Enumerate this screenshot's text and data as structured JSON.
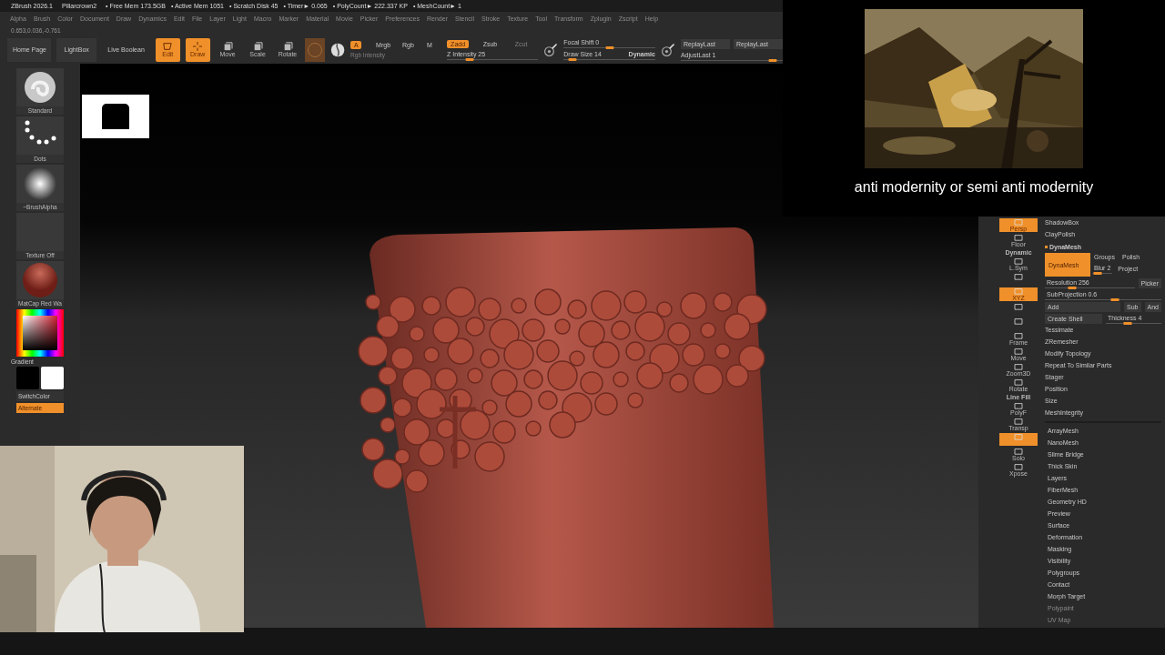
{
  "title_bar": {
    "app": "ZBrush 2026.1",
    "file": "Pillarcrown2",
    "stats": [
      "• Free Mem 173.5GB",
      "• Active Mem 1051",
      "• Scratch Disk 45",
      "• Timer► 0.065",
      "• PolyCount► 222.337 KP",
      "• MeshCount► 1"
    ]
  },
  "menus": [
    "Alpha",
    "Brush",
    "Color",
    "Document",
    "Draw",
    "Dynamics",
    "Edit",
    "File",
    "Layer",
    "Light",
    "Macro",
    "Marker",
    "Material",
    "Movie",
    "Picker",
    "Preferences",
    "Render",
    "Stencil",
    "Stroke",
    "Texture",
    "Tool",
    "Transform",
    "Zplugin",
    "Zscript",
    "Help"
  ],
  "coordinates": "0.653,0.036,-0.761",
  "nav_buttons": [
    "Home Page",
    "LightBox",
    "Live Boolean"
  ],
  "tools": [
    {
      "kind": "edit",
      "label": "Edit",
      "selected": true
    },
    {
      "kind": "draw",
      "label": "Draw",
      "selected": true
    },
    {
      "kind": "move",
      "label": "Move",
      "selected": false
    },
    {
      "kind": "scale",
      "label": "Scale",
      "selected": false
    },
    {
      "kind": "rotate",
      "label": "Rotate",
      "selected": false
    }
  ],
  "color_modes": [
    {
      "label": "A",
      "selected": true
    },
    {
      "label": "Mrgb",
      "selected": false
    },
    {
      "label": "Rgb",
      "selected": false
    },
    {
      "label": "M",
      "selected": false
    }
  ],
  "rgb_intensity": {
    "label": "Rgb Intensity",
    "disabled": true
  },
  "depth_modes": [
    {
      "label": "Zadd",
      "selected": true,
      "disabled": false
    },
    {
      "label": "Zsub",
      "selected": false,
      "disabled": false
    },
    {
      "label": "Zcut",
      "selected": false,
      "disabled": true
    }
  ],
  "z_intensity": {
    "label": "Z Intensity 25",
    "level": 0.25
  },
  "focal_shift": {
    "label": "Focal Shift 0",
    "level": 0.5
  },
  "draw_size": {
    "label": "Draw Size 14",
    "level": 0.1,
    "mode": "Dynamic"
  },
  "replay_buttons": [
    "ReplayLast",
    "ReplayLast"
  ],
  "adjust_last": {
    "label": "AdjustLast 1",
    "level": 0.9
  },
  "brush_tiles": [
    {
      "kind": "brush",
      "label": "Standard"
    },
    {
      "kind": "dots",
      "label": "Dots"
    },
    {
      "kind": "alpha",
      "label": "~BrushAlpha"
    },
    {
      "kind": "texture",
      "label": "Texture Off"
    },
    {
      "kind": "material",
      "label": "MatCap Red Wa"
    }
  ],
  "gradient_label": "Gradient",
  "switch_color": "SwitchColor",
  "alternate": {
    "label": "Alternate",
    "on": true
  },
  "view_tools": [
    {
      "kind": "button",
      "label": "Persp",
      "selected": true
    },
    {
      "kind": "button",
      "label": "Floor",
      "selected": false
    },
    {
      "kind": "caption",
      "label": "Dynamic"
    },
    {
      "kind": "button",
      "label": "L.Sym",
      "selected": false
    },
    {
      "kind": "button",
      "selected": false
    },
    {
      "kind": "button",
      "label": "XYZ",
      "selected": true
    },
    {
      "kind": "button",
      "selected": false
    },
    {
      "kind": "button",
      "selected": false
    },
    {
      "kind": "button",
      "label": "Frame",
      "selected": false
    },
    {
      "kind": "button",
      "label": "Move",
      "selected": false
    },
    {
      "kind": "button",
      "label": "Zoom3D",
      "selected": false
    },
    {
      "kind": "button",
      "label": "Rotate",
      "selected": false
    },
    {
      "kind": "caption",
      "label": "Line Fill"
    },
    {
      "kind": "button",
      "label": "PolyF",
      "selected": false
    },
    {
      "kind": "button",
      "label": "Transp",
      "selected": false
    },
    {
      "kind": "button",
      "selected": true
    },
    {
      "kind": "button",
      "label": "Solo",
      "selected": false
    },
    {
      "kind": "button",
      "label": "Xpose",
      "selected": false
    }
  ],
  "subpalette_items": [
    "ShadowBox",
    "ClayPolish"
  ],
  "dynamesh": {
    "title": "DynaMesh",
    "expanded": true,
    "button": {
      "label": "DynaMesh",
      "on": true
    },
    "groups": "Groups",
    "polish": "Polish",
    "blur": {
      "label": "Blur 2",
      "level": 0.25
    },
    "project": "Project",
    "resolution": {
      "label": "Resolution 256",
      "level": 0.3
    },
    "picker": "Picker",
    "subprojection": {
      "label": "SubProjection 0.6",
      "level": 0.6
    },
    "add": "Add",
    "sub": "Sub",
    "and": "And",
    "create_shell": "Create Shell",
    "thickness": {
      "label": "Thickness 4",
      "level": 0.4
    }
  },
  "geometry_items": [
    "Tessimate",
    "ZRemesher",
    "Modify Topology",
    "Repeat To Similar Parts",
    "Stager",
    "Position",
    "Size",
    "MeshIntegrity"
  ],
  "tool_items": [
    {
      "label": "ArrayMesh",
      "disabled": false
    },
    {
      "label": "NanoMesh",
      "disabled": false
    },
    {
      "label": "Slime Bridge",
      "disabled": false
    },
    {
      "label": "Thick Skin",
      "disabled": false
    },
    {
      "label": "Layers",
      "disabled": false
    },
    {
      "label": "FiberMesh",
      "disabled": false
    },
    {
      "label": "Geometry HD",
      "disabled": false
    },
    {
      "label": "Preview",
      "disabled": false
    },
    {
      "label": "Surface",
      "disabled": false
    },
    {
      "label": "Deformation",
      "disabled": false
    },
    {
      "label": "Masking",
      "disabled": false
    },
    {
      "label": "Visibility",
      "disabled": false
    },
    {
      "label": "Polygroups",
      "disabled": false
    },
    {
      "label": "Contact",
      "disabled": false
    },
    {
      "label": "Morph Target",
      "disabled": false
    },
    {
      "label": "Polypaint",
      "disabled": true
    },
    {
      "label": "UV Map",
      "disabled": true
    }
  ],
  "overlay_caption": "anti modernity or semi anti modernity"
}
